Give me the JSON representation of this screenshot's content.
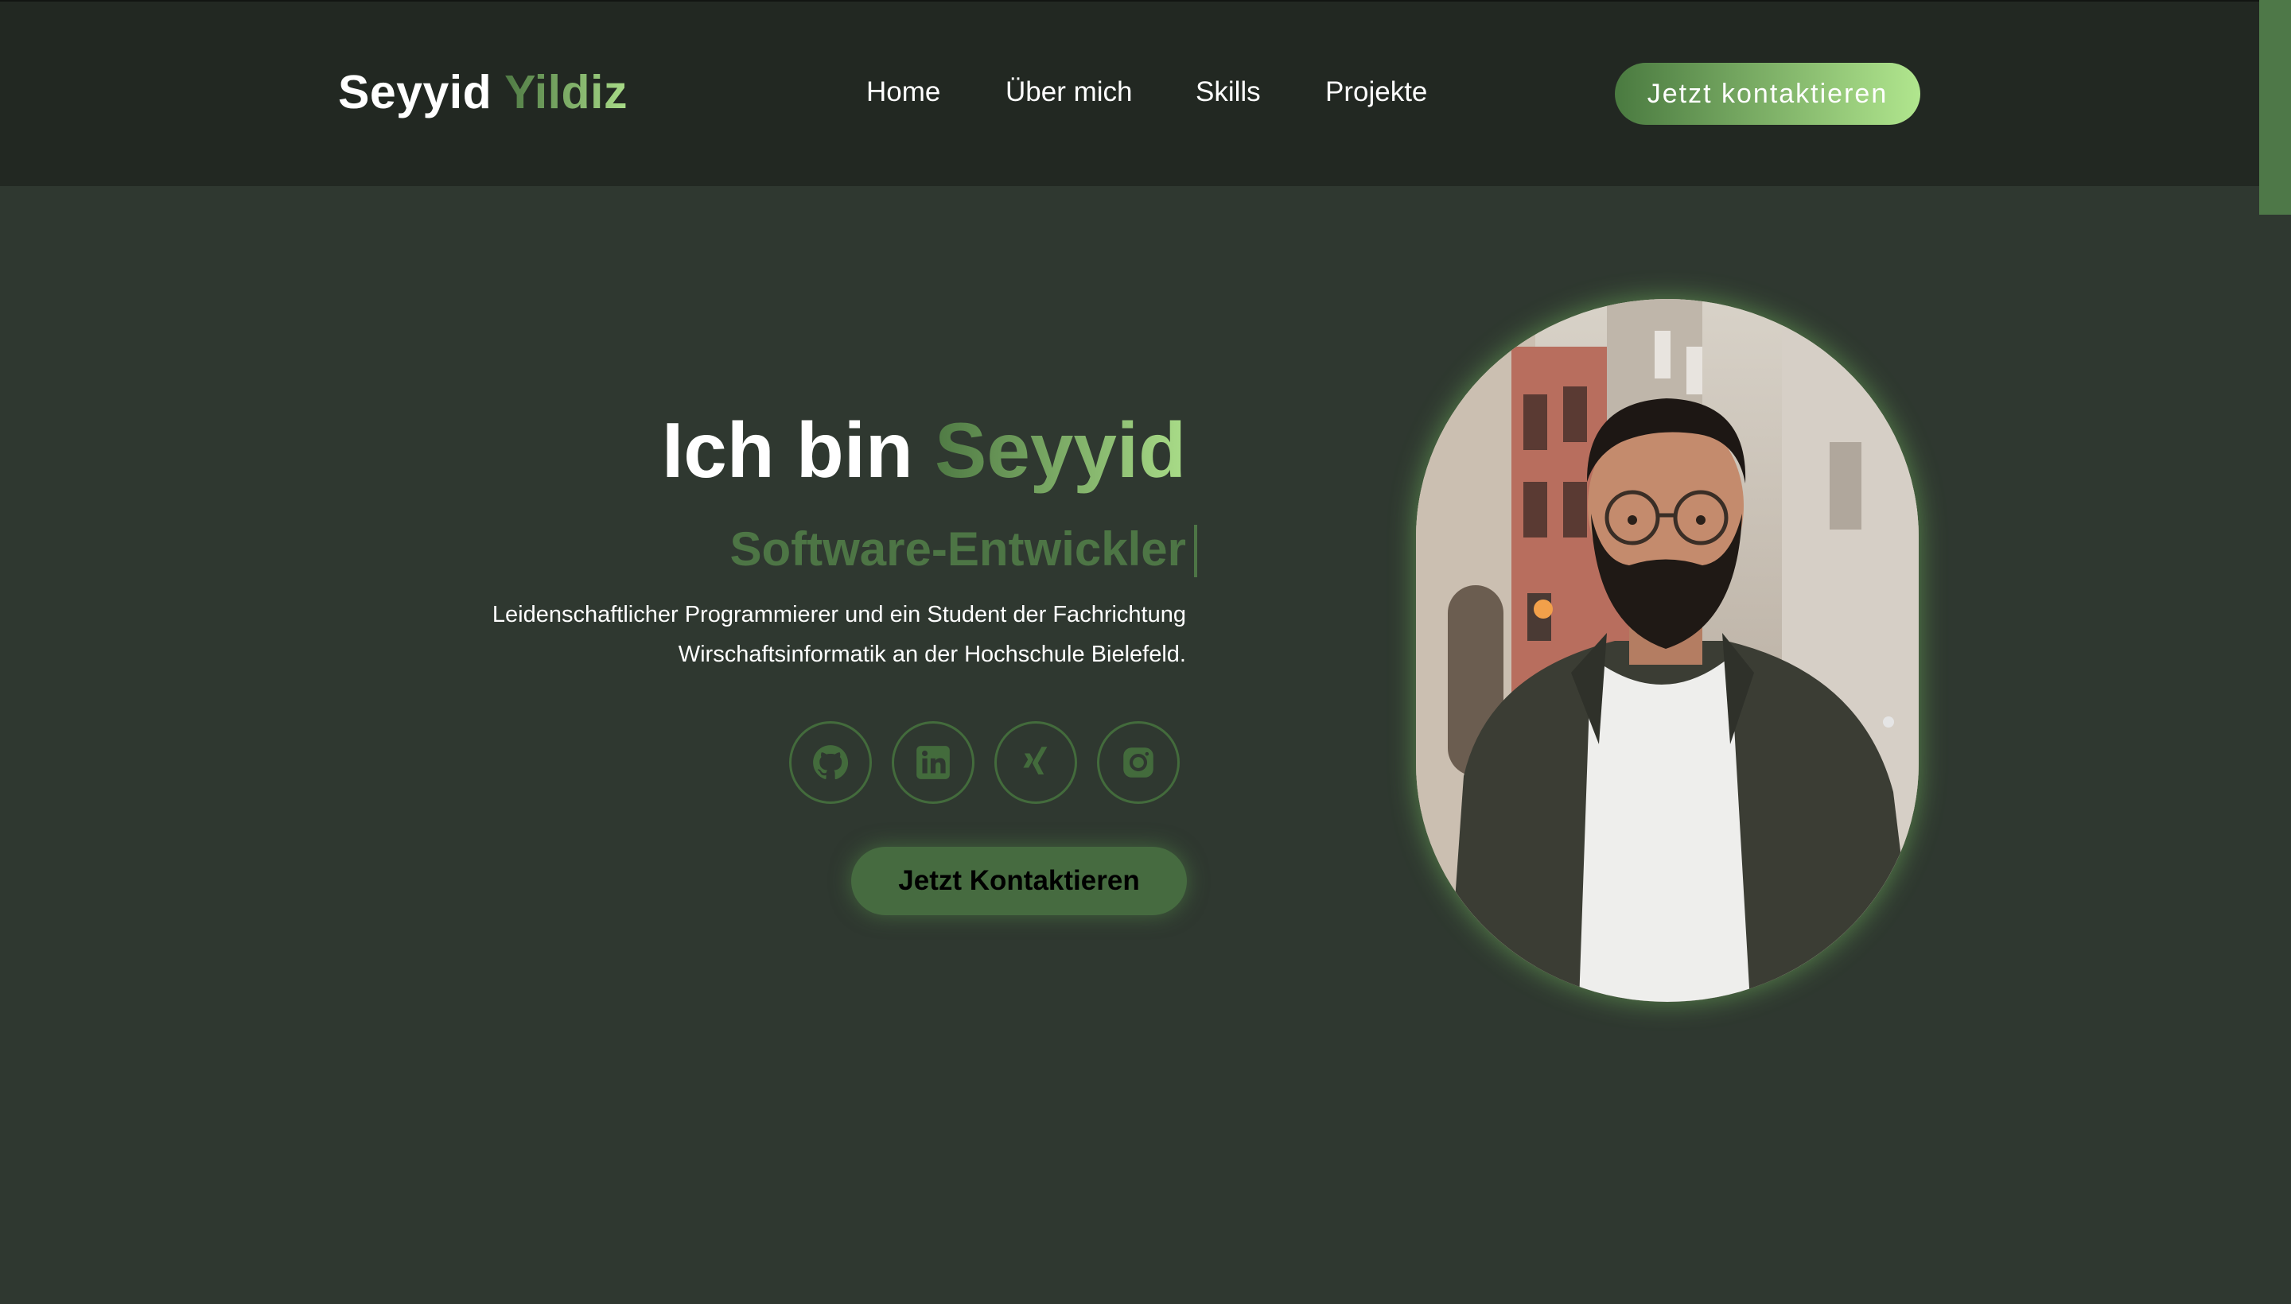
{
  "header": {
    "logo_first": "Seyyid",
    "logo_last": "Yildiz",
    "nav": [
      "Home",
      "Über mich",
      "Skills",
      "Projekte"
    ],
    "cta": "Jetzt kontaktieren"
  },
  "hero": {
    "title_prefix": "Ich bin",
    "title_highlight": "Seyyid",
    "role": "Software-Entwickler",
    "description_line1": "Leidenschaftlicher Programmierer und ein Student der Fachrichtung",
    "description_line2": "Wirschaftsinformatik an der Hochschule Bielefeld.",
    "social_icons": [
      "github-icon",
      "linkedin-icon",
      "xing-icon",
      "instagram-icon"
    ],
    "cta": "Jetzt Kontaktieren",
    "portrait": "portrait-photo"
  },
  "colors": {
    "background": "#2f3830",
    "navbar": "#222822",
    "accent_dark": "#4f7a44",
    "accent_light": "#a9dc88",
    "button": "#466b40"
  }
}
